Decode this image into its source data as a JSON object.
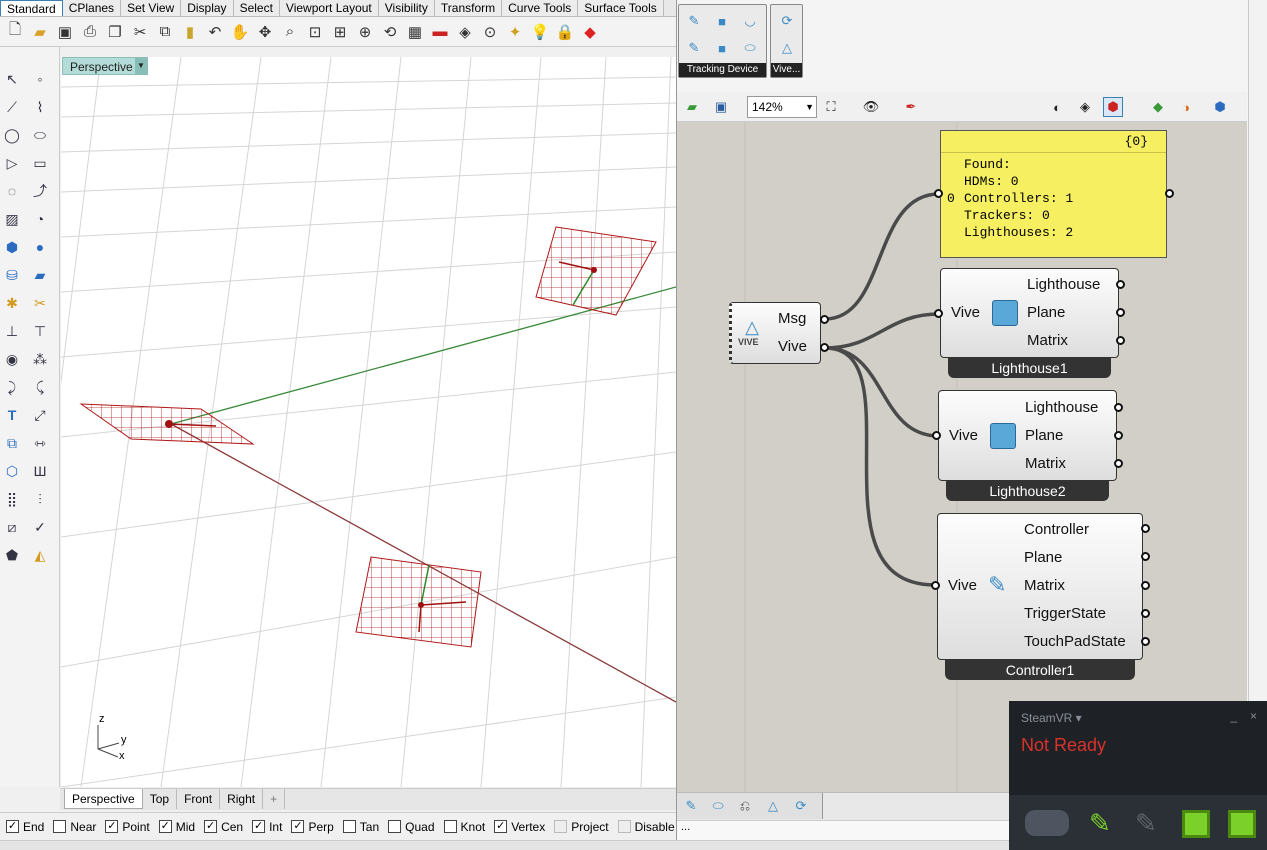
{
  "top_tabs": [
    "Standard",
    "CPlanes",
    "Set View",
    "Display",
    "Select",
    "Viewport Layout",
    "Visibility",
    "Transform",
    "Curve Tools",
    "Surface Tools"
  ],
  "top_tabs_active": "Standard",
  "viewport": {
    "label": "Perspective",
    "axis_z": "z",
    "axis_y": "y",
    "axis_x": "x"
  },
  "view_tabs": [
    "Perspective",
    "Top",
    "Front",
    "Right"
  ],
  "view_tab_add": "+",
  "osnaps": [
    {
      "label": "End",
      "checked": true
    },
    {
      "label": "Near",
      "checked": false
    },
    {
      "label": "Point",
      "checked": true
    },
    {
      "label": "Mid",
      "checked": true
    },
    {
      "label": "Cen",
      "checked": true
    },
    {
      "label": "Int",
      "checked": true
    },
    {
      "label": "Perp",
      "checked": true
    },
    {
      "label": "Tan",
      "checked": false
    },
    {
      "label": "Quad",
      "checked": false
    },
    {
      "label": "Knot",
      "checked": false
    },
    {
      "label": "Vertex",
      "checked": true
    },
    {
      "label": "Project",
      "checked": false,
      "disabled": true
    },
    {
      "label": "Disable",
      "checked": false,
      "disabled": true
    }
  ],
  "grasshopper": {
    "group_tracking": "Tracking Device",
    "group_vive": "Vive...",
    "zoom": "142%",
    "panel": {
      "header": "{0}",
      "index": "0",
      "lines": [
        "Found:",
        "HDMs: 0",
        "Controllers: 1",
        "Trackers: 0",
        "Lighthouses: 2"
      ]
    },
    "vive_component": {
      "logo": "VIVE",
      "out1": "Msg",
      "out2": "Vive"
    },
    "lighthouse1": {
      "input": "Vive",
      "outputs": [
        "Lighthouse",
        "Plane",
        "Matrix"
      ],
      "name": "Lighthouse1"
    },
    "lighthouse2": {
      "input": "Vive",
      "outputs": [
        "Lighthouse",
        "Plane",
        "Matrix"
      ],
      "name": "Lighthouse2"
    },
    "controller1": {
      "input": "Vive",
      "outputs": [
        "Controller",
        "Plane",
        "Matrix",
        "TriggerState",
        "TouchPadState"
      ],
      "name": "Controller1"
    },
    "status_text": "..."
  },
  "steamvr": {
    "title": "SteamVR ▾",
    "status": "Not Ready",
    "minimize": "_",
    "close": "×",
    "status_color": "#d9312b",
    "device_color": "#7bd12a"
  }
}
